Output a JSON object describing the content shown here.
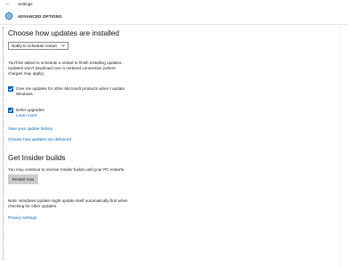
{
  "window": {
    "back_label": "←",
    "title": "Settings"
  },
  "header": {
    "title": "ADVANCED OPTIONS",
    "icon": "gear-icon"
  },
  "updates": {
    "heading": "Choose how updates are installed",
    "dropdown_value": "Notify to schedule restart",
    "restart_note_line1": "You'll be asked to schedule a restart to finish installing updates.",
    "restart_note_line2": "Updates won't download over a metered connection (where",
    "restart_note_line3": "charges may apply).",
    "microsoft_products_line1": "Give me updates for other Microsoft products when I update",
    "microsoft_products_line2": "Windows.",
    "microsoft_products_checked": true,
    "defer_label": "Defer upgrades",
    "defer_checked": true,
    "learn_more": "Learn more",
    "history_link": "View your update history",
    "delivery_link": "Choose how updates are delivered"
  },
  "insider": {
    "heading": "Get Insider builds",
    "desc": "You may continue to receive Insider builds until your PC restarts.",
    "restart_button": "Restart now"
  },
  "footer": {
    "note_line1": "Note: Windows Update might update itself automatically first when",
    "note_line2": "checking for other updates.",
    "privacy_link": "Privacy settings"
  },
  "colors": {
    "accent": "#0063b1",
    "button_bg": "#cccccc"
  }
}
